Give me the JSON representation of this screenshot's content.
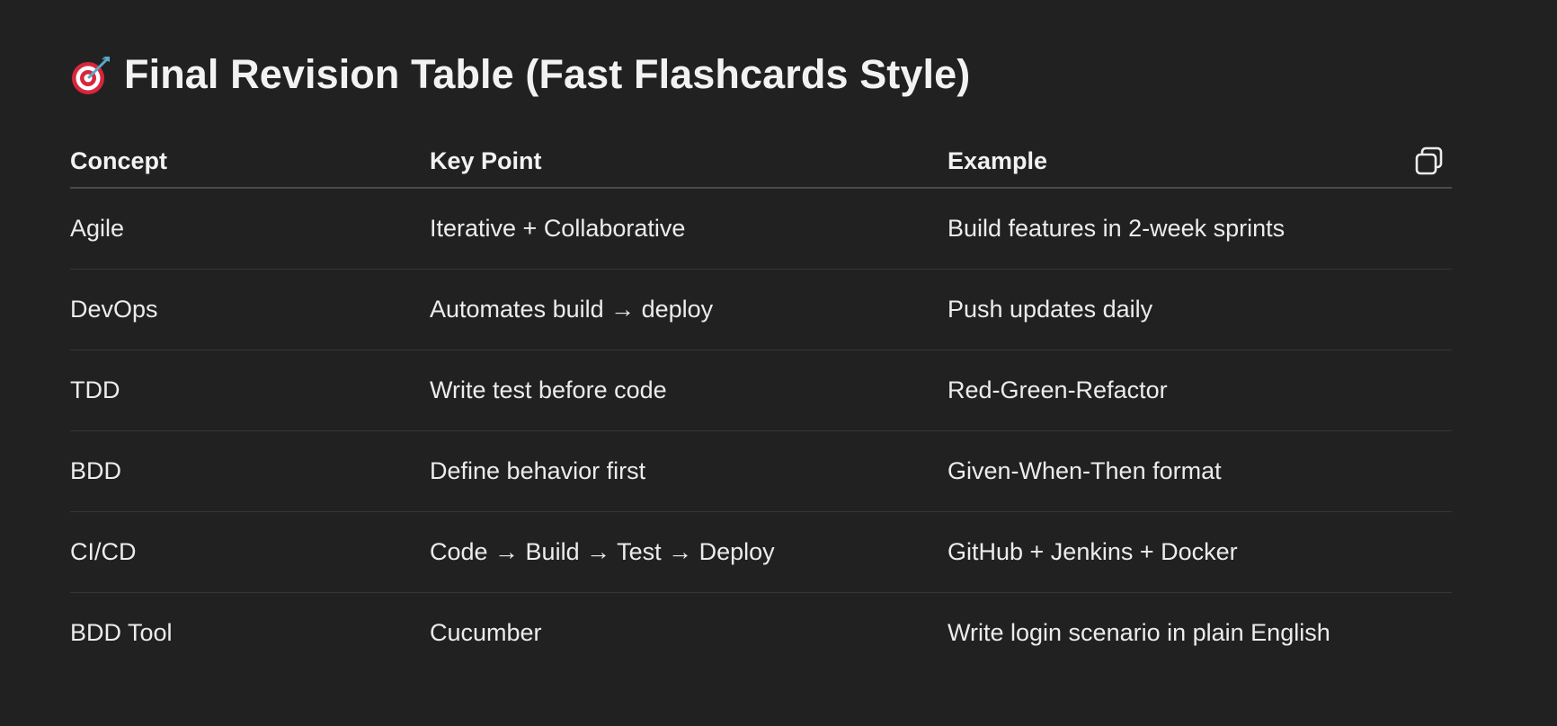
{
  "page": {
    "title": "Final Revision Table (Fast Flashcards Style)",
    "title_icon": "direct-hit-target-icon"
  },
  "table": {
    "headers": [
      "Concept",
      "Key Point",
      "Example"
    ],
    "rows": [
      [
        "Agile",
        "Iterative + Collaborative",
        "Build features in 2-week sprints"
      ],
      [
        "DevOps",
        "Automates build → deploy",
        "Push updates daily"
      ],
      [
        "TDD",
        "Write test before code",
        "Red-Green-Refactor"
      ],
      [
        "BDD",
        "Define behavior first",
        "Given-When-Then format"
      ],
      [
        "CI/CD",
        "Code → Build → Test → Deploy",
        "GitHub + Jenkins + Docker"
      ],
      [
        "BDD Tool",
        "Cucumber",
        "Write login scenario in plain English"
      ]
    ],
    "copy_icon": "copy-icon"
  },
  "colors": {
    "background": "#212121",
    "text": "#ececec",
    "header_rule": "#4a4a4a",
    "row_rule": "#353535"
  }
}
